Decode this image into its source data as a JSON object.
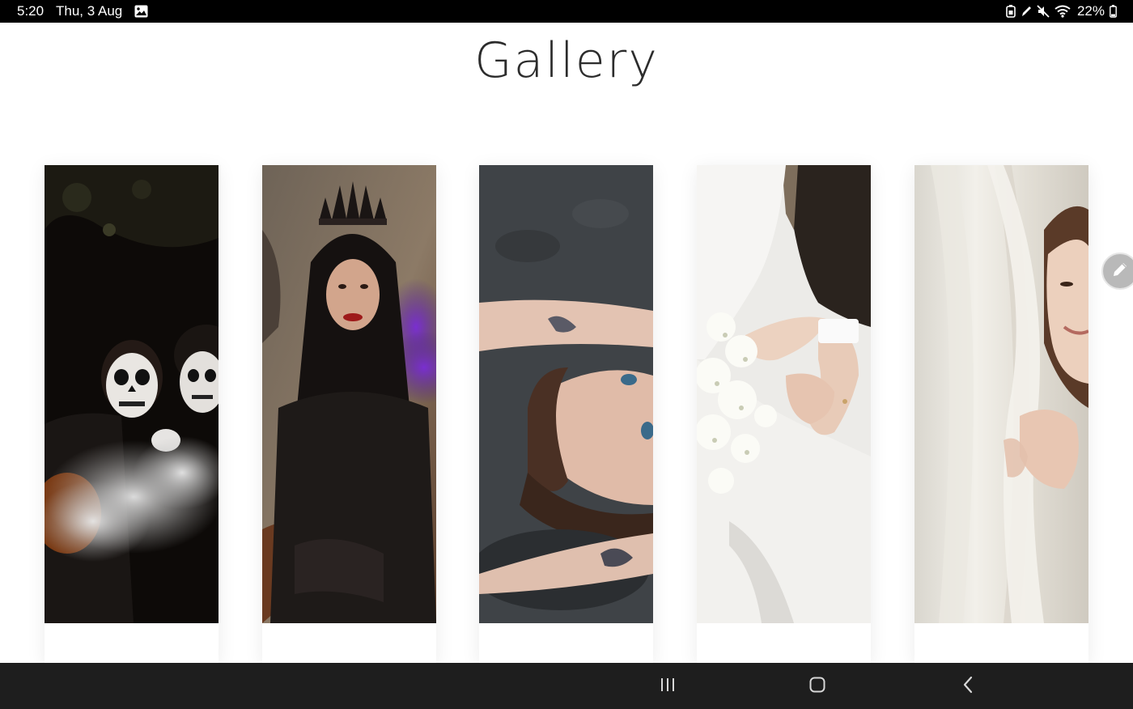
{
  "status_bar": {
    "time": "5:20",
    "date": "Thu, 3 Aug",
    "battery_percent": "22%",
    "icons": [
      "gallery-notification-icon",
      "battery-saver-icon",
      "stylus-icon",
      "mute-icon",
      "wifi-icon",
      "battery-icon"
    ]
  },
  "page": {
    "title": "Gallery"
  },
  "gallery": {
    "items": [
      {
        "subject": "two people with skull face paint holding a pumpkin in smoke"
      },
      {
        "subject": "woman in black wearing a spiked crown with purple smoke"
      },
      {
        "subject": "woman lying on the ground with tattooed arms"
      },
      {
        "subject": "bride and groom holding hands with baby's breath bouquet"
      },
      {
        "subject": "smiling bride peeking from behind a white curtain"
      }
    ]
  },
  "floating": {
    "edit_icon": "pencil-icon"
  },
  "nav_bar": {
    "buttons": [
      "recent-apps-icon",
      "home-icon",
      "back-icon"
    ]
  },
  "colors": {
    "status_bar": "#000000",
    "nav_bar": "#1e1e1e",
    "title_text": "#2c2c2c",
    "fab": "#b9b9b9"
  }
}
